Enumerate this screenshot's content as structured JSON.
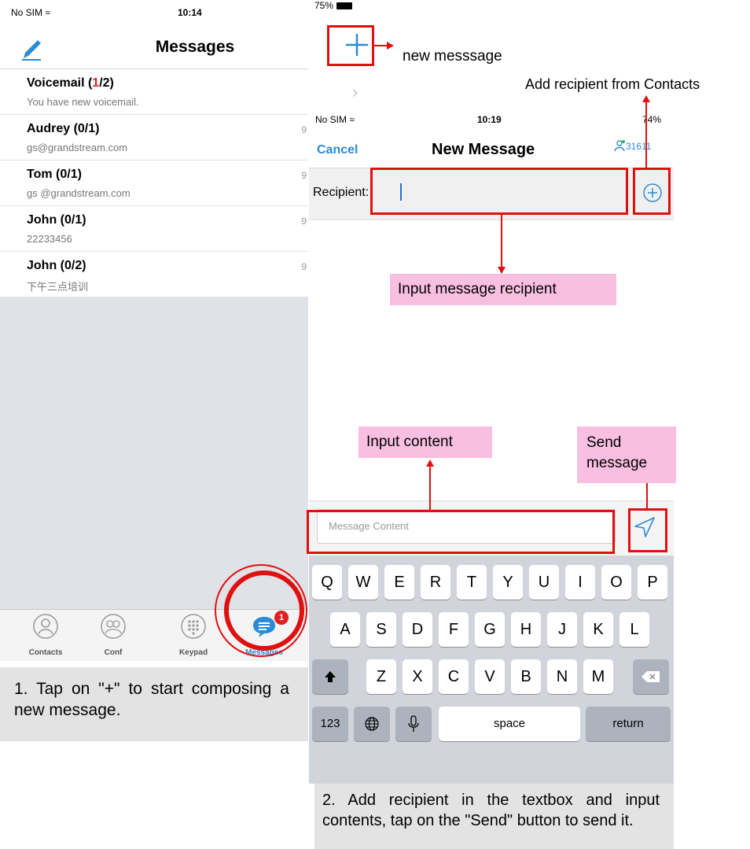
{
  "left_phone": {
    "status": {
      "carrier": "No SIM ≈",
      "time": "10:14"
    },
    "title": "Messages",
    "messages": [
      {
        "name_pre": "Voicemail (",
        "name_red": "1",
        "name_post": "/2)",
        "preview": "You have new voicemail.",
        "time": ""
      },
      {
        "name_pre": "Audrey  (0/1)",
        "name_red": "",
        "name_post": "",
        "preview": "gs@grandstream.com",
        "time": "9"
      },
      {
        "name_pre": "Tom (0/1)",
        "name_red": "",
        "name_post": "",
        "preview": "gs @grandstream.com",
        "time": "9"
      },
      {
        "name_pre": "John  (0/1)",
        "name_red": "",
        "name_post": "",
        "preview": "22233456",
        "time": "9"
      },
      {
        "name_pre": "John  (0/2)",
        "name_red": "",
        "name_post": "",
        "preview": "下午三点培训",
        "time": "9"
      }
    ],
    "tabs": [
      {
        "label": "Contacts",
        "icon": "contacts-icon"
      },
      {
        "label": "Conf",
        "icon": "conference-icon"
      },
      {
        "label": "Keypad",
        "icon": "keypad-icon"
      },
      {
        "label": "Messages",
        "icon": "messages-icon",
        "badge": "1"
      }
    ],
    "caption": "1.  Tap  on  \"+\"  to  start composing a new message."
  },
  "right_phone": {
    "top_status": {
      "battery": "75%"
    },
    "status": {
      "carrier": "No SIM ≈",
      "time": "10:19",
      "battery": "74%"
    },
    "nav": {
      "cancel": "Cancel",
      "title": "New Message",
      "account": "31611"
    },
    "recipient_label": "Recipient:",
    "content_placeholder": "Message Content",
    "keyboard": {
      "row1": [
        "Q",
        "W",
        "E",
        "R",
        "T",
        "Y",
        "U",
        "I",
        "O",
        "P"
      ],
      "row2": [
        "A",
        "S",
        "D",
        "F",
        "G",
        "H",
        "J",
        "K",
        "L"
      ],
      "row3": [
        "Z",
        "X",
        "C",
        "V",
        "B",
        "N",
        "M"
      ],
      "numbers": "123",
      "space": "space",
      "return": "return"
    },
    "caption": "2. Add recipient in the textbox and input contents, tap on the \"Send\" button to send it."
  },
  "annotations": {
    "new_message": "new messsage",
    "add_recipient": "Add recipient from Contacts",
    "input_recipient": "Input message recipient",
    "input_content": "Input content",
    "send_message": "Send message"
  },
  "colors": {
    "accent": "#2c8bd6",
    "annotation_red": "#e01010",
    "callout_pink": "#f8bfe0",
    "badge_red": "#e02020"
  }
}
